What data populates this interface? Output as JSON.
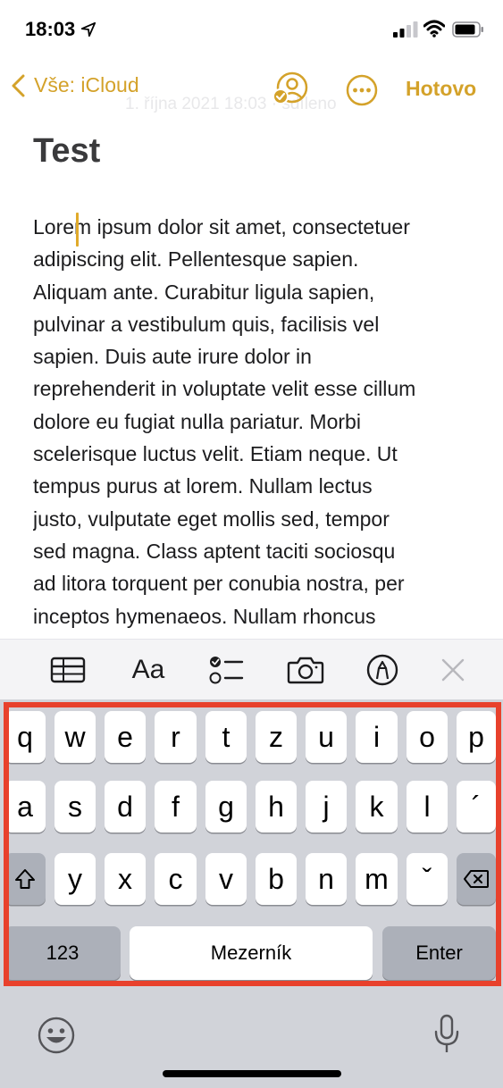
{
  "status_bar": {
    "time": "18:03"
  },
  "nav": {
    "back_label": "Vše: iCloud",
    "subtitle": "1. října 2021 18:03 · sdíleno",
    "done_label": "Hotovo"
  },
  "note": {
    "title": "Test",
    "body_lines": [
      "Lorem ipsum dolor sit amet, consectetuer",
      "adipiscing elit. Pellentesque sapien.",
      "Aliquam ante. Curabitur ligula sapien,",
      "pulvinar a vestibulum quis, facilisis vel",
      "sapien. Duis aute irure dolor in",
      "reprehenderit in voluptate velit esse cillum",
      "dolore eu fugiat nulla pariatur. Morbi",
      "scelerisque luctus velit. Etiam neque. Ut",
      "tempus purus at lorem. Nullam lectus",
      "justo, vulputate eget mollis sed, tempor",
      "sed magna. Class aptent taciti sociosqu",
      "ad litora torquent per conubia nostra, per",
      "inceptos hymenaeos. Nullam rhoncus"
    ]
  },
  "toolbar": {
    "format_label": "Aa"
  },
  "keyboard": {
    "row1": [
      "q",
      "w",
      "e",
      "r",
      "t",
      "z",
      "u",
      "i",
      "o",
      "p"
    ],
    "row2": [
      "a",
      "s",
      "d",
      "f",
      "g",
      "h",
      "j",
      "k",
      "l",
      "´"
    ],
    "row3": [
      "y",
      "x",
      "c",
      "v",
      "b",
      "n",
      "m",
      "ˇ"
    ],
    "numbers_label": "123",
    "space_label": "Mezerník",
    "enter_label": "Enter"
  },
  "colors": {
    "accent": "#d4a22a",
    "highlight_frame": "#e8412c"
  }
}
